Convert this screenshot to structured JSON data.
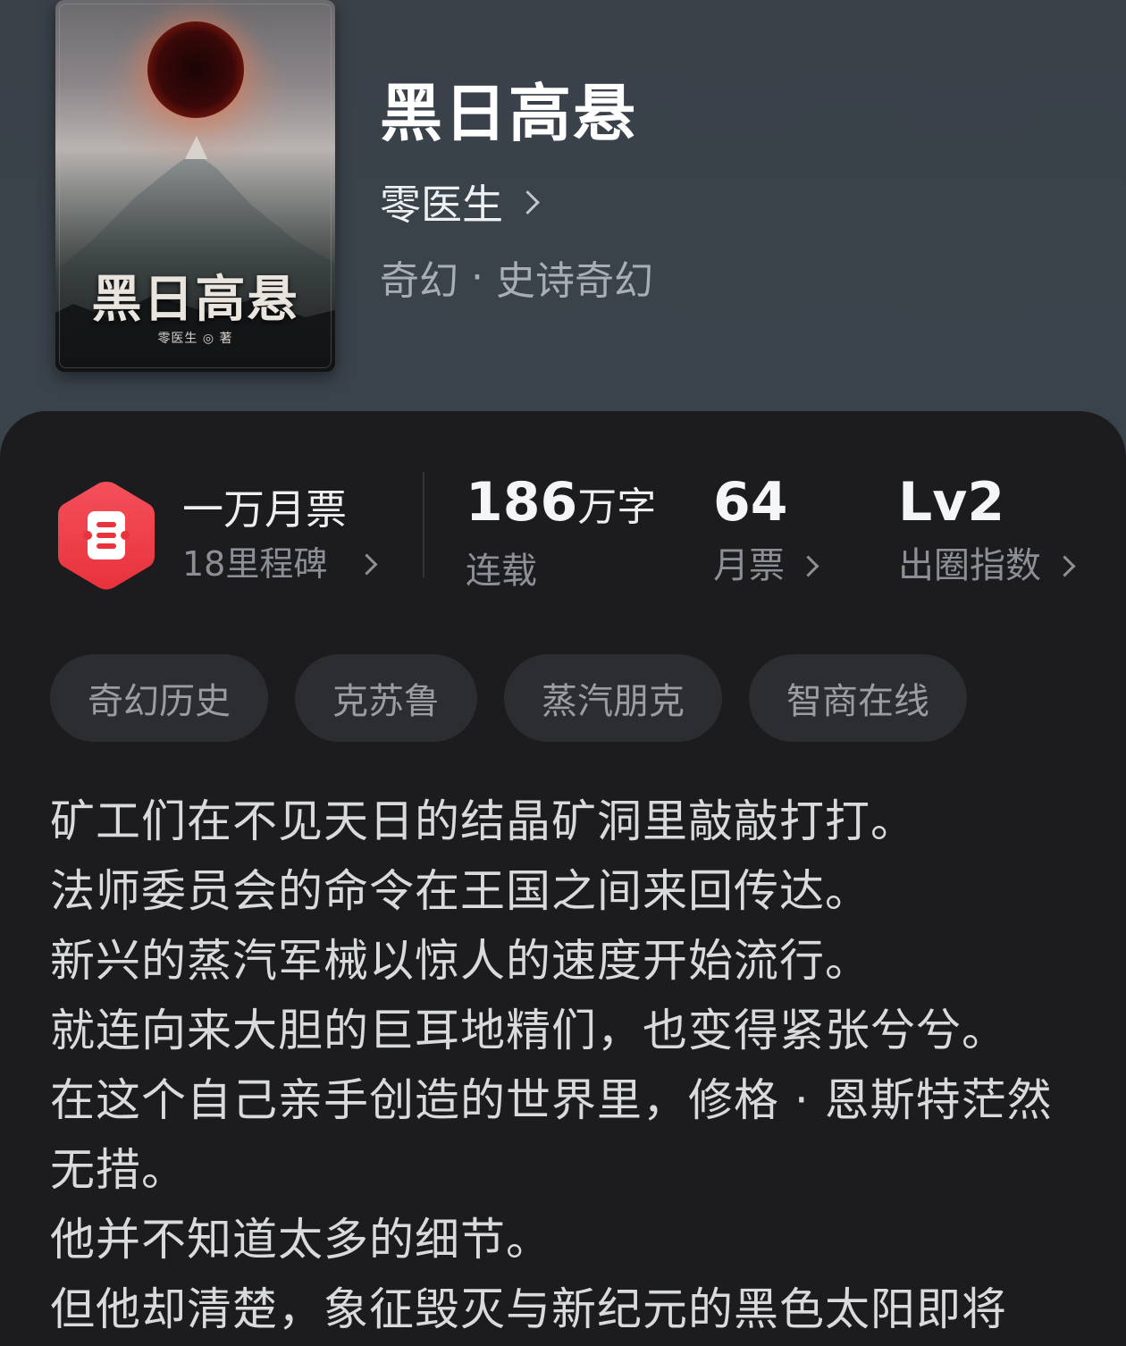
{
  "book": {
    "cover_title": "黑日高悬",
    "cover_author": "零医生 ◎ 著",
    "title": "黑日高悬",
    "author": "零医生",
    "genre_main": "奇幻",
    "genre_separator": "·",
    "genre_sub": "史诗奇幻"
  },
  "badge": {
    "icon": "ticket-icon",
    "color": "#f0464e",
    "title": "一万月票",
    "subtitle": "18里程碑"
  },
  "stats": {
    "words_value": "186",
    "words_unit": "万字",
    "words_label": "连载",
    "tickets_value": "64",
    "tickets_label": "月票",
    "index_value": "Lv2",
    "index_label": "出圈指数"
  },
  "tags": [
    "奇幻历史",
    "克苏鲁",
    "蒸汽朋克",
    "智商在线"
  ],
  "synopsis": [
    "矿工们在不见天日的结晶矿洞里敲敲打打。",
    "法师委员会的命令在王国之间来回传达。",
    "新兴的蒸汽军械以惊人的速度开始流行。",
    "就连向来大胆的巨耳地精们，也变得紧张兮兮。",
    "在这个自己亲手创造的世界里，修格 · 恩斯特茫然无措。",
    "他并不知道太多的细节。",
    "但他却清楚，象征毁灭与新纪元的黑色太阳即将"
  ]
}
